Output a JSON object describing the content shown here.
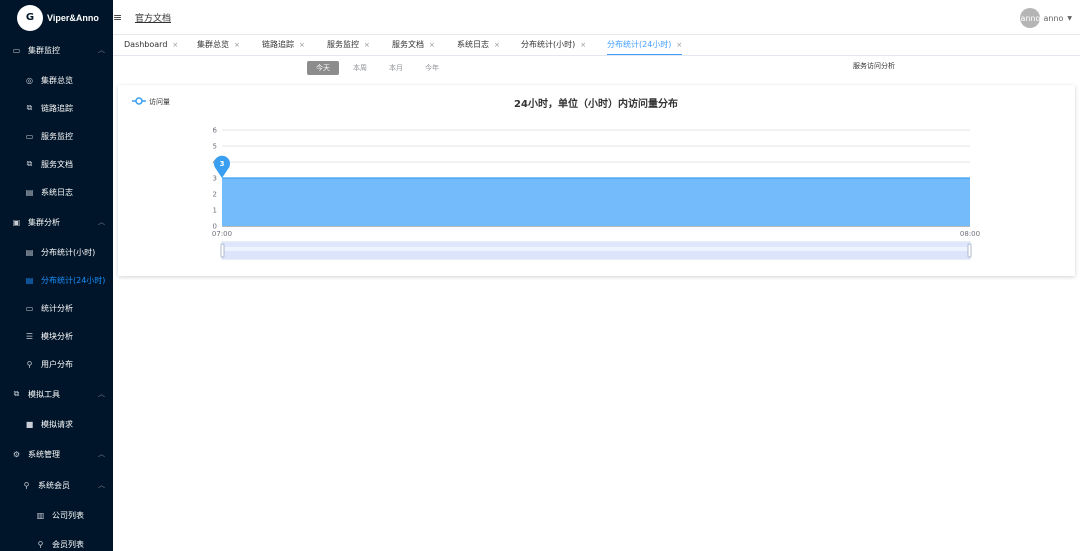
{
  "app": {
    "logo_text": "Viper&Anno",
    "logo_glyph": "G"
  },
  "header": {
    "menu_icon": "≡",
    "docs_link": "官方文档",
    "avatar_text": "anno",
    "username": "anno",
    "caret": "▼"
  },
  "sidebar": {
    "groups": [
      {
        "label": "集群监控",
        "icon": "monitor-icon",
        "items": [
          "集群总览",
          "链路追踪",
          "服务监控",
          "服务文档",
          "系统日志"
        ]
      },
      {
        "label": "集群分析",
        "icon": "box-icon",
        "items": [
          "分布统计(小时)",
          "分布统计(24小时)",
          "统计分析",
          "模块分析",
          "用户分布"
        ]
      },
      {
        "label": "模拟工具",
        "icon": "tool-icon",
        "items": [
          "模拟请求"
        ]
      },
      {
        "label": "系统管理",
        "icon": "gear-icon",
        "items": []
      },
      {
        "label": "系统会员",
        "icon": "user-icon",
        "items": [
          "公司列表",
          "会员列表"
        ]
      }
    ],
    "active_item": "分布统计(24小时)"
  },
  "tabs": [
    {
      "label": "Dashboard"
    },
    {
      "label": "集群总览"
    },
    {
      "label": "链路追踪"
    },
    {
      "label": "服务监控"
    },
    {
      "label": "服务文档"
    },
    {
      "label": "系统日志"
    },
    {
      "label": "分布统计(小时)"
    },
    {
      "label": "分布统计(24小时)",
      "active": true
    }
  ],
  "tab_close": "×",
  "periods": [
    {
      "label": "今天",
      "selected": true
    },
    {
      "label": "本周"
    },
    {
      "label": "本月"
    },
    {
      "label": "今年"
    }
  ],
  "analysis_title": "服务访问分析",
  "colors": {
    "sidebar_bg": "#001529",
    "accent": "#409eff",
    "area_fill": "#74bbfb",
    "area_line": "#3a9ff1"
  },
  "chart_data": {
    "type": "area",
    "title": "24小时，单位（小时）内访问量分布",
    "legend": [
      "访问量"
    ],
    "legend_position": "top-left",
    "x": [
      "07:00",
      "08:00"
    ],
    "series": [
      {
        "name": "访问量",
        "values": [
          3,
          3
        ]
      }
    ],
    "ylim": [
      0,
      6
    ],
    "yticks": [
      0,
      1,
      2,
      3,
      4,
      5,
      6
    ],
    "grid": true,
    "max_marker": {
      "x": "07:00",
      "value": 3
    },
    "data_zoom": true
  }
}
